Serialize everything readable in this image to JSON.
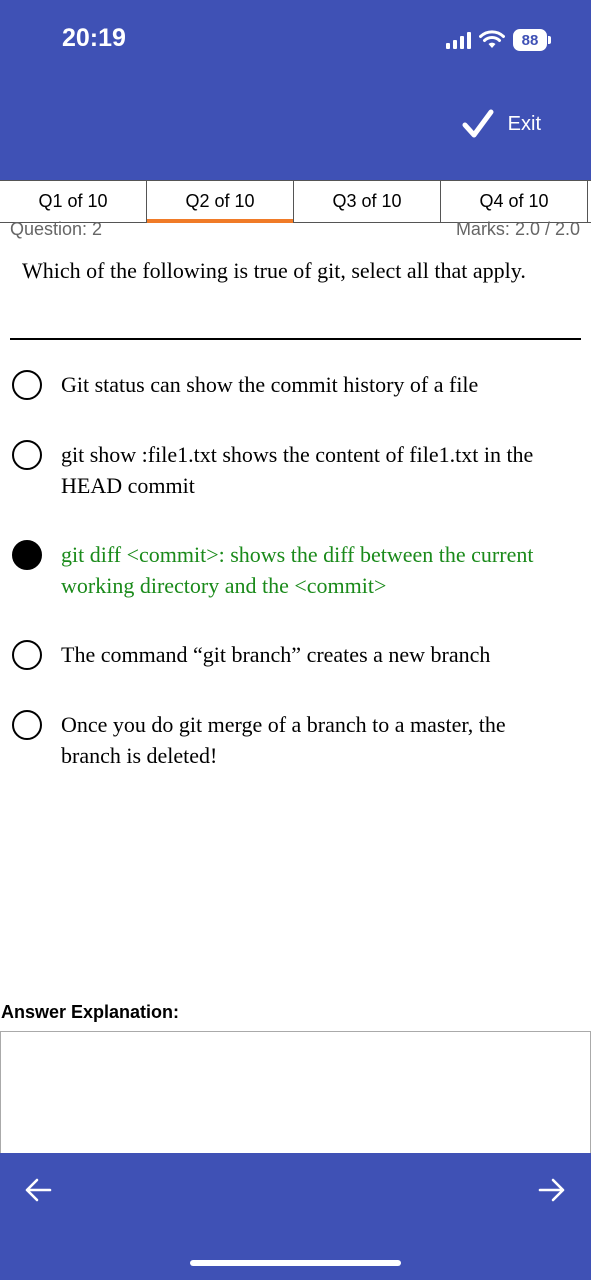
{
  "status_bar": {
    "time": "20:19",
    "battery": "88"
  },
  "header": {
    "exit_label": "Exit"
  },
  "tabs": [
    {
      "label": "Q1 of 10",
      "active": false
    },
    {
      "label": "Q2 of 10",
      "active": true
    },
    {
      "label": "Q3 of 10",
      "active": false
    },
    {
      "label": "Q4 of 10",
      "active": false
    }
  ],
  "question_meta": {
    "question_number": "Question: 2",
    "marks": "Marks: 2.0 / 2.0"
  },
  "question": {
    "text": "Which of the following is true of git, select all that apply."
  },
  "options": [
    {
      "text": "Git status can show the commit history of a file",
      "selected": false
    },
    {
      "text": "git show :file1.txt shows the content of file1.txt in the HEAD commit",
      "selected": false
    },
    {
      "text": "git diff <commit>: shows the diff between the current working directory and the <commit>",
      "selected": true
    },
    {
      "text": "The command “git branch” creates a new branch",
      "selected": false
    },
    {
      "text": "Once you do git merge of a branch to a master, the branch is deleted!",
      "selected": false
    }
  ],
  "explanation": {
    "label": "Answer Explanation:",
    "text": ""
  },
  "colors": {
    "primary": "#3f51b5",
    "active_tab_indicator": "#f07b28",
    "correct_answer": "#1a8a1a"
  },
  "icons": {
    "signal": "cellular-signal-icon",
    "wifi": "wifi-icon",
    "battery": "battery-icon",
    "check": "checkmark-icon",
    "prev": "arrow-left-icon",
    "next": "arrow-right-icon"
  }
}
